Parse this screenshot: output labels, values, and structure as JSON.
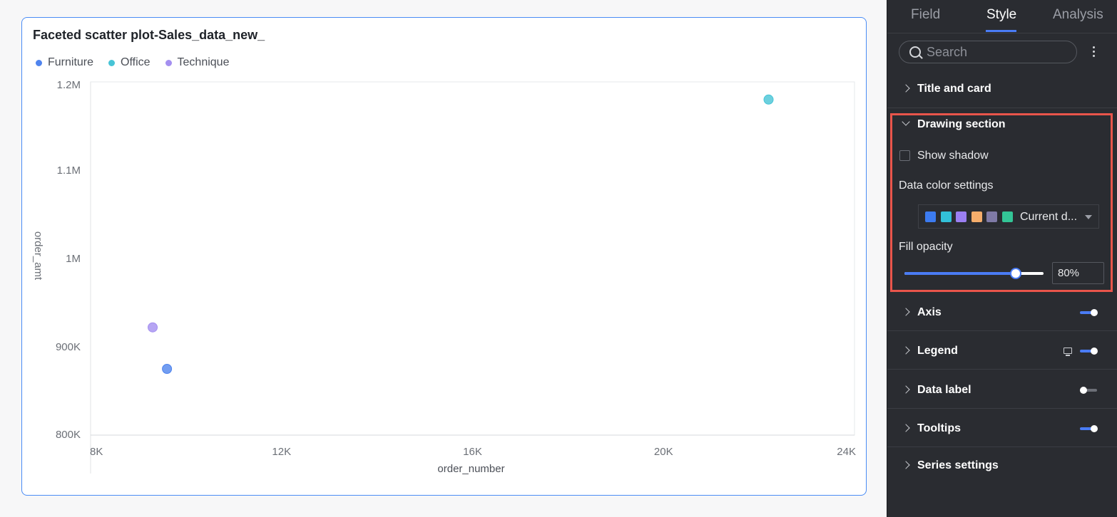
{
  "chart_card": {
    "title": "Faceted scatter plot-Sales_data_new_",
    "legend": [
      {
        "label": "Furniture",
        "color": "#4f84ee"
      },
      {
        "label": "Office",
        "color": "#47c4d6"
      },
      {
        "label": "Technique",
        "color": "#a48ff0"
      }
    ]
  },
  "chart_data": {
    "type": "scatter",
    "title": "Faceted scatter plot-Sales_data_new_",
    "xlabel": "order_number",
    "ylabel": "order_amt",
    "xlim": [
      8000,
      24000
    ],
    "ylim": [
      800000,
      1200000
    ],
    "x_ticks": [
      "8K",
      "12K",
      "16K",
      "20K",
      "24K"
    ],
    "x_tick_values": [
      8000,
      12000,
      16000,
      20000,
      24000
    ],
    "y_ticks": [
      "800K",
      "900K",
      "1M",
      "1.1M",
      "1.2M"
    ],
    "y_tick_values": [
      800000,
      900000,
      1000000,
      1100000,
      1200000
    ],
    "grid": false,
    "legend_position": "top-left",
    "series": [
      {
        "name": "Furniture",
        "color": "#4f84ee",
        "points": [
          {
            "x": 9600,
            "y": 875000
          }
        ]
      },
      {
        "name": "Office",
        "color": "#47c4d6",
        "points": [
          {
            "x": 22200,
            "y": 1180000
          }
        ]
      },
      {
        "name": "Technique",
        "color": "#a48ff0",
        "points": [
          {
            "x": 9300,
            "y": 922000
          }
        ]
      }
    ]
  },
  "panel": {
    "tabs": [
      {
        "label": "Field",
        "active": false
      },
      {
        "label": "Style",
        "active": true
      },
      {
        "label": "Analysis",
        "active": false
      }
    ],
    "search": {
      "placeholder": "Search"
    },
    "sections": {
      "title_card": "Title and card",
      "drawing": "Drawing section",
      "axis": "Axis",
      "legend": "Legend",
      "data_label": "Data label",
      "tooltips": "Tooltips",
      "series": "Series settings"
    },
    "toggles": {
      "axis": true,
      "legend": true,
      "data_label": false,
      "tooltips": true
    },
    "drawing": {
      "show_shadow_label": "Show shadow",
      "show_shadow_checked": false,
      "data_color_label": "Data color settings",
      "color_scheme_value": "Current d...",
      "color_scheme_swatches": [
        "#3c7bf0",
        "#32c0d8",
        "#9b7ff2",
        "#f5ad6b",
        "#7f7aa6",
        "#33c596"
      ],
      "fill_opacity_label": "Fill opacity",
      "fill_opacity_value": "80%",
      "fill_opacity_fraction": 0.8
    }
  }
}
